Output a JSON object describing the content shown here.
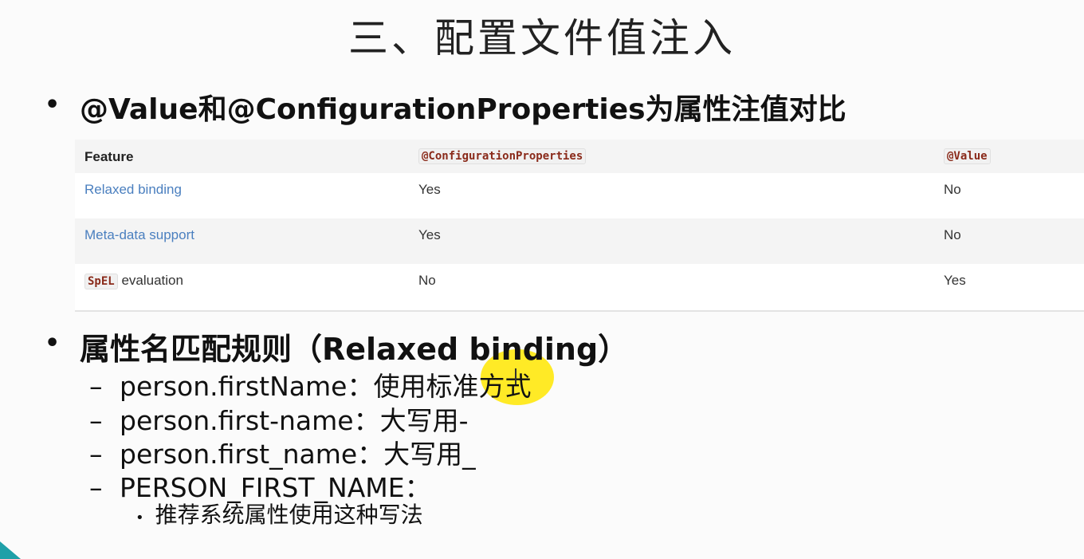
{
  "title": "三、配置文件值注入",
  "bullet_glyph": "•",
  "heading_1": "@Value和@ConfigurationProperties为属性注值对比",
  "table": {
    "headers": [
      "Feature",
      "@ConfigurationProperties",
      "@Value"
    ],
    "rows": [
      {
        "feature": "Relaxed binding",
        "config_props": "Yes",
        "value": "No"
      },
      {
        "feature": "Meta-data support",
        "config_props": "Yes",
        "value": "No"
      },
      {
        "feature_code": "SpEL",
        "feature_text": "evaluation",
        "config_props": "No",
        "value": "Yes"
      }
    ]
  },
  "heading_2": "属性名匹配规则（Relaxed binding）",
  "dash_glyph": "–",
  "rules": [
    "person.firstName：使用标准方式",
    "person.first-name：大写用-",
    "person.first_name：大写用_",
    "PERSON_FIRST_NAME："
  ],
  "rule_note": "推荐系统属性使用这种写法",
  "colors": {
    "link": "#4a7fbf",
    "code_text": "#8a2a1a",
    "highlight": "#ffe600",
    "corner_accent": "#1fa0a8"
  }
}
